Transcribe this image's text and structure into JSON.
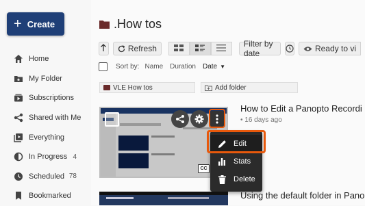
{
  "sidebar": {
    "create_label": "Create",
    "items": [
      {
        "label": "Home",
        "icon": "home-icon"
      },
      {
        "label": "My Folder",
        "icon": "my-folder-icon"
      },
      {
        "label": "Subscriptions",
        "icon": "subscriptions-icon"
      },
      {
        "label": "Shared with Me",
        "icon": "share-icon"
      },
      {
        "label": "Everything",
        "icon": "everything-icon"
      },
      {
        "label": "In Progress",
        "icon": "in-progress-icon",
        "count": "4"
      },
      {
        "label": "Scheduled",
        "icon": "scheduled-icon",
        "count": "78"
      },
      {
        "label": "Bookmarked",
        "icon": "bookmark-icon"
      }
    ]
  },
  "header": {
    "folder_title": ".How tos"
  },
  "toolbar": {
    "refresh_label": "Refresh",
    "filter_label": "Filter by date",
    "ready_label": "Ready to vi"
  },
  "sort": {
    "label": "Sort by:",
    "options": [
      "Name",
      "Duration",
      "Date"
    ],
    "active": "Date"
  },
  "subfolders": {
    "vle_label": "VLE How tos",
    "add_label": "Add folder"
  },
  "videos": [
    {
      "title": "How to Edit a Panopto Recordi",
      "meta": "• 16 days ago"
    },
    {
      "title": "Using the default folder in Panopto"
    }
  ],
  "context_menu": {
    "items": [
      "Edit",
      "Stats",
      "Delete"
    ]
  },
  "badges": {
    "cc": "CC"
  },
  "colors": {
    "accent": "#1f3f77",
    "highlight": "#e8590c",
    "folder": "#6a2b2b",
    "menu_bg": "#2b2b2b"
  }
}
